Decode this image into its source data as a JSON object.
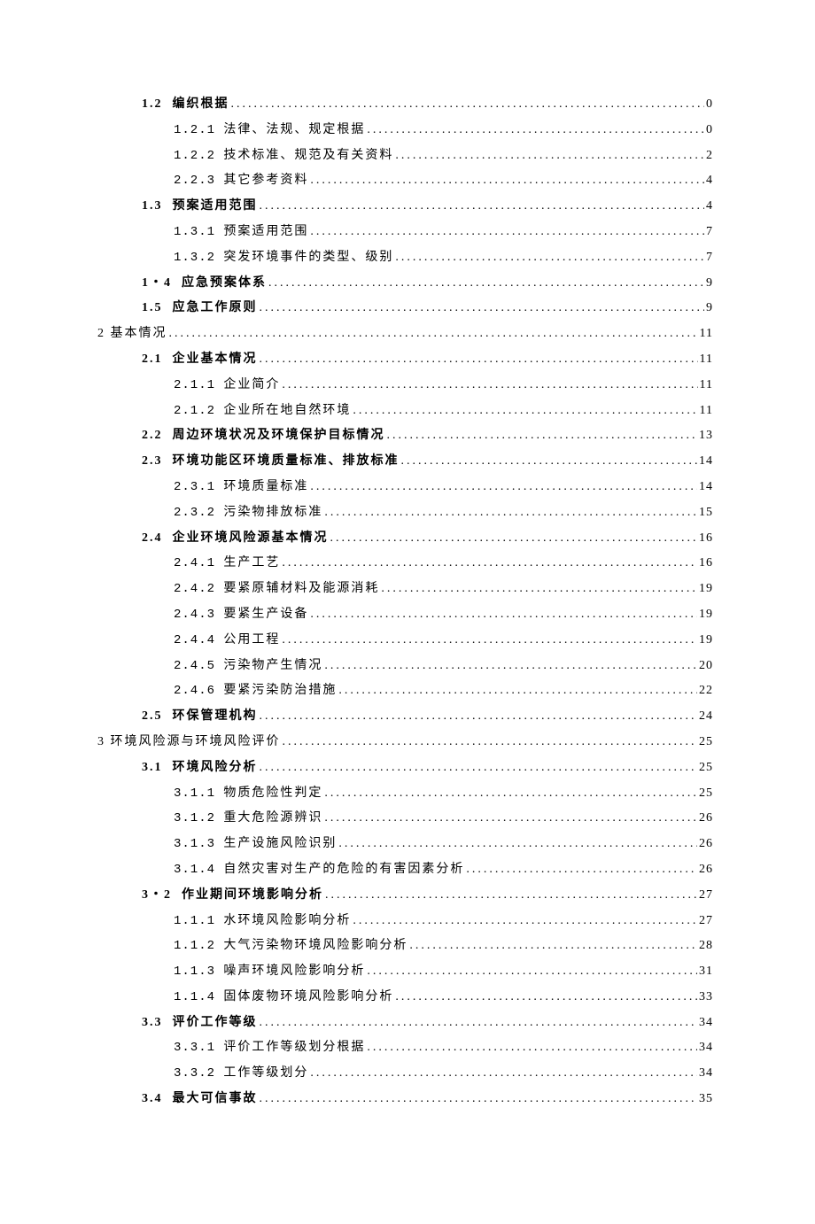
{
  "toc": [
    {
      "level": 1,
      "bold": true,
      "num": "1.2",
      "title": "编织根据",
      "page": "0"
    },
    {
      "level": 2,
      "bold": false,
      "num": "1.2.1",
      "numMono": true,
      "title": "法律、法规、规定根据",
      "page": "0"
    },
    {
      "level": 2,
      "bold": false,
      "num": "1.2.2",
      "numMono": true,
      "title": "技术标准、规范及有关资料",
      "page": "2"
    },
    {
      "level": 2,
      "bold": false,
      "num": "2.2.3",
      "numMono": true,
      "title": "其它参考资料",
      "page": "4"
    },
    {
      "level": 1,
      "bold": true,
      "num": "1.3",
      "title": "预案适用范围",
      "page": "4"
    },
    {
      "level": 2,
      "bold": false,
      "num": "1.3.1",
      "numMono": true,
      "title": "预案适用范围",
      "page": "7"
    },
    {
      "level": 2,
      "bold": false,
      "num": "1.3.2",
      "numMono": true,
      "title": "突发环境事件的类型、级别",
      "page": "7"
    },
    {
      "level": 1,
      "bold": true,
      "num": "1・4",
      "title": "应急预案体系",
      "page": "9"
    },
    {
      "level": 1,
      "bold": true,
      "num": "1.5",
      "title": "应急工作原则",
      "page": "9"
    },
    {
      "level": 0,
      "bold": false,
      "num": "2",
      "title": "基本情况",
      "page": "11"
    },
    {
      "level": 1,
      "bold": true,
      "num": "2.1",
      "title": "企业基本情况",
      "page": "11"
    },
    {
      "level": 2,
      "bold": false,
      "num": "2.1.1",
      "numMono": true,
      "title": "企业简介",
      "page": "11"
    },
    {
      "level": 2,
      "bold": false,
      "num": "2.1.2",
      "numMono": true,
      "title": "企业所在地自然环境",
      "page": "11"
    },
    {
      "level": 1,
      "bold": true,
      "num": "2.2",
      "title": "周边环境状况及环境保护目标情况",
      "page": "13"
    },
    {
      "level": 1,
      "bold": true,
      "num": "2.3",
      "title": "环境功能区环境质量标准、排放标准",
      "page": "14"
    },
    {
      "level": 2,
      "bold": false,
      "num": "2.3.1",
      "numMono": true,
      "title": "环境质量标准",
      "page": "14"
    },
    {
      "level": 2,
      "bold": false,
      "num": "2.3.2",
      "numMono": true,
      "title": "污染物排放标准",
      "page": "15"
    },
    {
      "level": 1,
      "bold": true,
      "num": "2.4",
      "title": "企业环境风险源基本情况",
      "page": "16"
    },
    {
      "level": 2,
      "bold": false,
      "num": "2.4.1",
      "numMono": true,
      "title": "生产工艺",
      "page": "16"
    },
    {
      "level": 2,
      "bold": false,
      "num": "2.4.2",
      "numMono": true,
      "title": "要紧原辅材料及能源消耗",
      "page": "19"
    },
    {
      "level": 2,
      "bold": false,
      "num": "2.4.3",
      "numMono": true,
      "title": "要紧生产设备",
      "page": "19"
    },
    {
      "level": 2,
      "bold": false,
      "num": "2.4.4",
      "numMono": true,
      "title": "公用工程",
      "page": "19"
    },
    {
      "level": 2,
      "bold": false,
      "num": "2.4.5",
      "numMono": true,
      "title": "污染物产生情况",
      "page": "20"
    },
    {
      "level": 2,
      "bold": false,
      "num": "2.4.6",
      "numMono": true,
      "title": "要紧污染防治措施",
      "page": "22"
    },
    {
      "level": 1,
      "bold": true,
      "num": "2.5",
      "title": "环保管理机构",
      "page": "24"
    },
    {
      "level": 0,
      "bold": false,
      "num": "3",
      "title": "环境风险源与环境风险评价",
      "page": "25"
    },
    {
      "level": 1,
      "bold": true,
      "num": "3.1",
      "title": "环境风险分析",
      "page": "25"
    },
    {
      "level": 2,
      "bold": false,
      "num": "3.1.1",
      "numMono": true,
      "title": "物质危险性判定",
      "page": "25"
    },
    {
      "level": 2,
      "bold": false,
      "num": "3.1.2",
      "numMono": true,
      "title": "重大危险源辨识",
      "page": "26"
    },
    {
      "level": 2,
      "bold": false,
      "num": "3.1.3",
      "numMono": true,
      "title": "生产设施风险识别",
      "page": "26"
    },
    {
      "level": 2,
      "bold": false,
      "num": "3.1.4",
      "numMono": true,
      "title": "自然灾害对生产的危险的有害因素分析",
      "page": "26"
    },
    {
      "level": 1,
      "bold": true,
      "num": "3・2",
      "title": "作业期间环境影响分析",
      "page": "27"
    },
    {
      "level": 2,
      "bold": false,
      "num": "1.1.1",
      "numMono": true,
      "title": "水环境风险影响分析",
      "page": "27"
    },
    {
      "level": 2,
      "bold": false,
      "num": "1.1.2",
      "numMono": true,
      "title": "大气污染物环境风险影响分析",
      "page": "28"
    },
    {
      "level": 2,
      "bold": false,
      "num": "1.1.3",
      "numMono": true,
      "title": "噪声环境风险影响分析",
      "page": "31"
    },
    {
      "level": 2,
      "bold": false,
      "num": "1.1.4",
      "numMono": true,
      "title": "固体废物环境风险影响分析",
      "page": "33"
    },
    {
      "level": 1,
      "bold": true,
      "num": "3.3",
      "title": "评价工作等级",
      "page": "34"
    },
    {
      "level": 2,
      "bold": false,
      "num": "3.3.1",
      "numMono": true,
      "title": "评价工作等级划分根据",
      "page": "34"
    },
    {
      "level": 2,
      "bold": false,
      "num": "3.3.2",
      "numMono": true,
      "title": "工作等级划分",
      "page": "34"
    },
    {
      "level": 1,
      "bold": true,
      "num": "3.4",
      "title": "最大可信事故",
      "page": "35"
    }
  ],
  "leaderChar": ".",
  "pageSpacer": ""
}
